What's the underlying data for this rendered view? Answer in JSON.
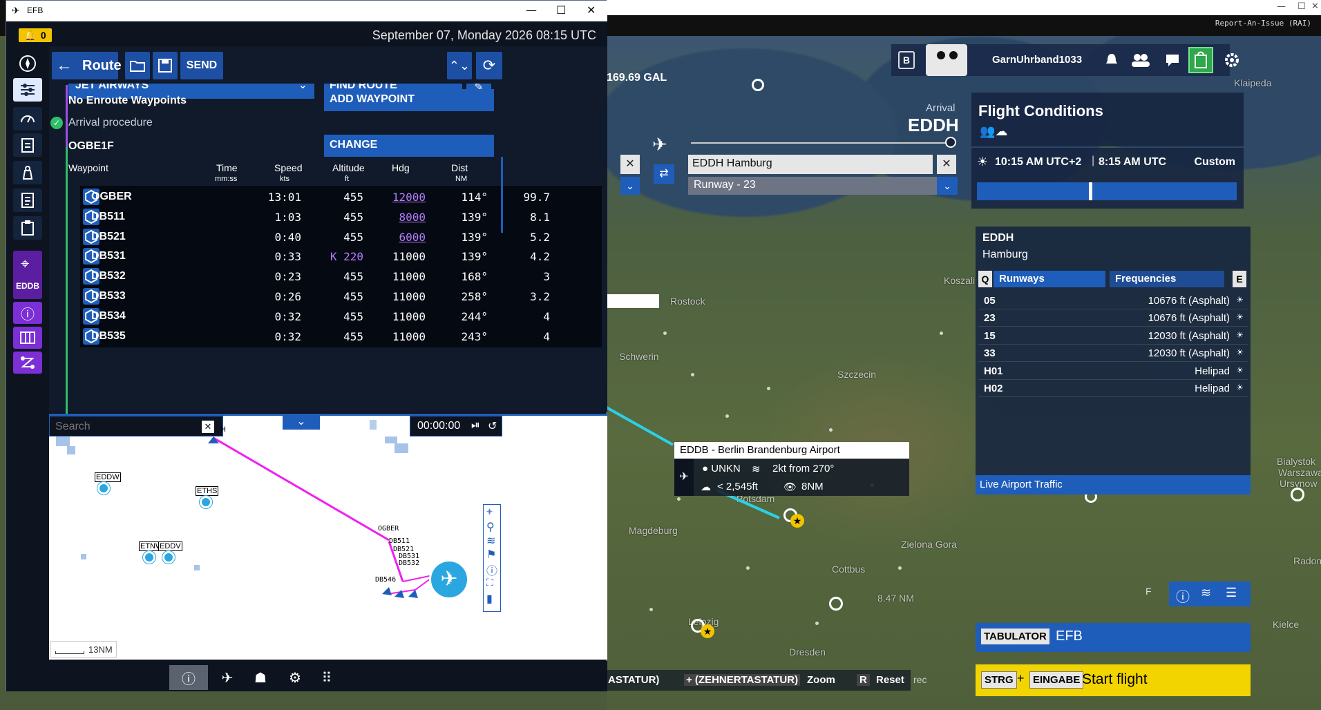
{
  "sim": {
    "report_issue": "Report-An-Issue (RAI)",
    "fuel": "169.69 GAL",
    "username": "GarnUhrband1033",
    "badge_b": "B",
    "arrival": {
      "label": "Arrival",
      "code": "EDDH",
      "airport": "EDDH Hamburg",
      "runway": "Runway - 23"
    },
    "map_labels": [
      "Klaipeda",
      "Rostock",
      "Koszalin",
      "Schwerin",
      "Szczecin",
      "Potsdam",
      "Magdeburg",
      "Zielona Gora",
      "Cottbus",
      "Dresden",
      "Leipzig",
      "Kielce",
      "Bialystok",
      "Warszawa",
      "Radom",
      "Ursynow"
    ],
    "map_label_nm": "8.47 NM",
    "flight_conditions": {
      "title": "Flight Conditions",
      "time_local": "10:15 AM UTC+2",
      "time_utc": "8:15 AM UTC",
      "custom": "Custom"
    },
    "airport_panel": {
      "code": "EDDH",
      "city": "Hamburg",
      "q": "Q",
      "e": "E",
      "tab_runways": "Runways",
      "tab_freq": "Frequencies",
      "runways": [
        {
          "id": "05",
          "info": "10676 ft (Asphalt)"
        },
        {
          "id": "23",
          "info": "10676 ft (Asphalt)"
        },
        {
          "id": "15",
          "info": "12030 ft (Asphalt)"
        },
        {
          "id": "33",
          "info": "12030 ft (Asphalt)"
        },
        {
          "id": "H01",
          "info": "Helipad"
        },
        {
          "id": "H02",
          "info": "Helipad"
        }
      ],
      "live_traffic": "Live Airport Traffic"
    },
    "tooltip": {
      "title": "EDDB - Berlin Brandenburg Airport",
      "unkn": "UNKN",
      "wind": "2kt from 270°",
      "ceiling": "< 2,545ft",
      "vis": "8NM"
    },
    "tabulator": {
      "key": "TABULATOR",
      "label": "EFB"
    },
    "start": {
      "key1": "STRG",
      "plus": "+",
      "key2": "EINGABE",
      "label": "Start flight"
    },
    "hints": {
      "h1": "ASTATUR)",
      "h2": "+ (ZEHNERTASTATUR)",
      "h2b": "Zoom",
      "h3": "R",
      "h3b": "Reset",
      "h4": "rec"
    },
    "f_label": "F"
  },
  "efb": {
    "title": "EFB",
    "alert_count": "0",
    "datetime": "September 07, Monday 2026 08:15 UTC",
    "side_eddb": "EDDB",
    "header": {
      "title": "Route",
      "send": "SEND"
    },
    "airway": "JET AIRWAYS",
    "find_route": "FIND ROUTE",
    "no_enroute": "No Enroute Waypoints",
    "add_waypoint": "ADD WAYPOINT",
    "arrival_proc": "Arrival procedure",
    "procedure": "OGBE1F",
    "change": "CHANGE",
    "cols": {
      "wp": "Waypoint",
      "time": "Time",
      "time_u": "mm:ss",
      "speed": "Speed",
      "speed_u": "kts",
      "alt": "Altitude",
      "alt_u": "ft",
      "hdg": "Hdg",
      "dist": "Dist",
      "dist_u": "NM"
    },
    "rows": [
      {
        "wp": "OGBER",
        "time": "13:01",
        "speed": "455",
        "alt": "12000",
        "hdg": "114°",
        "dist": "99.7"
      },
      {
        "wp": "DB511",
        "time": "1:03",
        "speed": "455",
        "alt": "8000",
        "hdg": "139°",
        "dist": "8.1"
      },
      {
        "wp": "DB521",
        "time": "0:40",
        "speed": "455",
        "alt": "6000",
        "hdg": "139°",
        "dist": "5.2"
      },
      {
        "wp": "DB531",
        "time": "0:33",
        "speed": "K 220",
        "alt": "11000",
        "hdg": "139°",
        "dist": "4.2"
      },
      {
        "wp": "DB532",
        "time": "0:23",
        "speed": "455",
        "alt": "11000",
        "hdg": "168°",
        "dist": "3"
      },
      {
        "wp": "DB533",
        "time": "0:26",
        "speed": "455",
        "alt": "11000",
        "hdg": "258°",
        "dist": "3.2"
      },
      {
        "wp": "DB534",
        "time": "0:32",
        "speed": "455",
        "alt": "11000",
        "hdg": "244°",
        "dist": "4"
      },
      {
        "wp": "DB535",
        "time": "0:32",
        "speed": "455",
        "alt": "11000",
        "hdg": "243°",
        "dist": "4"
      }
    ],
    "map": {
      "search_placeholder": "Search",
      "timer": "00:00:00",
      "scale": "13NM",
      "airports": [
        "EDDW",
        "ETHS",
        "ETNW",
        "EDDV"
      ],
      "waypoints": [
        "OGBER",
        "DB511",
        "DB521",
        "DB531",
        "DB532",
        "DB546"
      ],
      "h_label": "H"
    }
  }
}
